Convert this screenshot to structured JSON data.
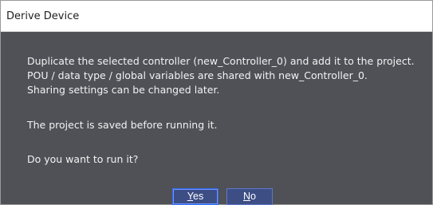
{
  "window": {
    "title": "Derive Device"
  },
  "message": {
    "line1": "Duplicate the selected controller (new_Controller_0) and add it to the project.",
    "line2": "POU / data type / global variables are shared with new_Controller_0.",
    "line3": "Sharing settings can be changed later.",
    "line4": "The project is saved before running it.",
    "line5": "Do you want to run it?"
  },
  "buttons": {
    "yes": {
      "mnemonic": "Y",
      "rest": "es"
    },
    "no": {
      "mnemonic": "N",
      "rest": "o"
    }
  },
  "colors": {
    "title_background": "#ffffff",
    "body_background": "#4f5157",
    "button_background": "#3d4e85",
    "button_border": "#5f78c8",
    "text_light": "#f2f2f2"
  }
}
